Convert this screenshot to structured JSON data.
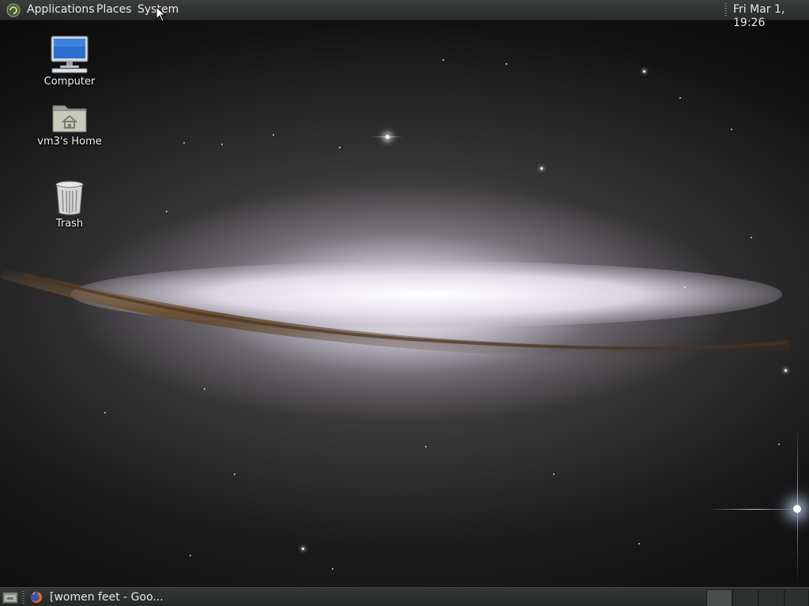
{
  "top_panel": {
    "menus": {
      "applications": "Applications",
      "places": "Places",
      "system": "System"
    },
    "clock": "Fri Mar 1, 19:26"
  },
  "desktop": {
    "icons": [
      {
        "label": "Computer",
        "icon": "computer-icon"
      },
      {
        "label": "vm3's Home",
        "icon": "home-folder-icon"
      },
      {
        "label": "Trash",
        "icon": "trash-icon"
      }
    ],
    "wallpaper": "galaxy-wallpaper"
  },
  "bottom_panel": {
    "tasks": [
      {
        "label": "[women feet - Goo...",
        "icon": "firefox-icon"
      }
    ],
    "workspaces": 4,
    "active_workspace": 1
  },
  "colors": {
    "panel_bg": "#2f3131",
    "panel_text": "#e6e6e6"
  }
}
